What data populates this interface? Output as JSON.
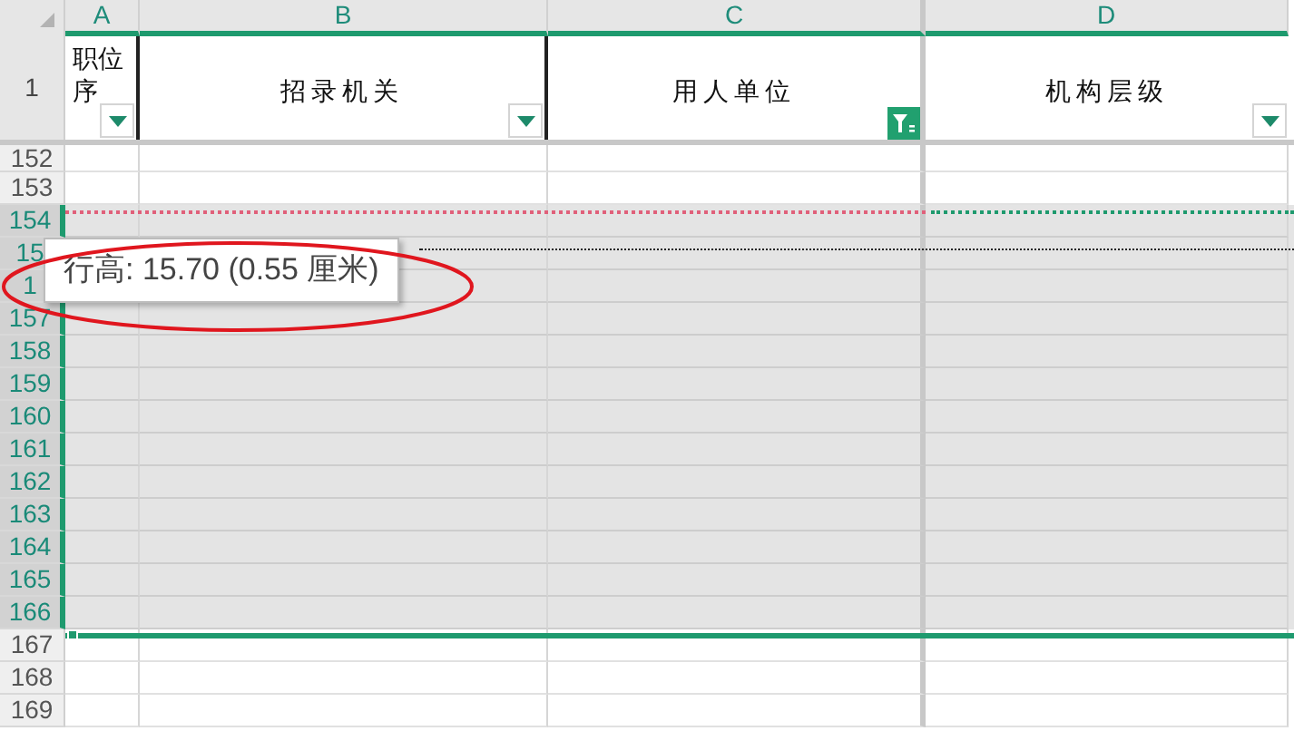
{
  "columns": [
    {
      "letter": "A",
      "title": "职位序",
      "filtered": false
    },
    {
      "letter": "B",
      "title": "招录机关",
      "filtered": false
    },
    {
      "letter": "C",
      "title": "用人单位",
      "filtered": true
    },
    {
      "letter": "D",
      "title": "机构层级",
      "filtered": false
    }
  ],
  "header_row": "1",
  "rows": [
    {
      "number": "152",
      "selected": false
    },
    {
      "number": "153",
      "selected": false
    },
    {
      "number": "154",
      "selected": true
    },
    {
      "number": "15",
      "selected": true
    },
    {
      "number": "1",
      "selected": true
    },
    {
      "number": "157",
      "selected": true
    },
    {
      "number": "158",
      "selected": true
    },
    {
      "number": "159",
      "selected": true
    },
    {
      "number": "160",
      "selected": true
    },
    {
      "number": "161",
      "selected": true
    },
    {
      "number": "162",
      "selected": true
    },
    {
      "number": "163",
      "selected": true
    },
    {
      "number": "164",
      "selected": true
    },
    {
      "number": "165",
      "selected": true
    },
    {
      "number": "166",
      "selected": true
    },
    {
      "number": "167",
      "selected": false
    },
    {
      "number": "168",
      "selected": false
    },
    {
      "number": "169",
      "selected": false
    }
  ],
  "tooltip": "行高: 15.70 (0.55 厘米)"
}
